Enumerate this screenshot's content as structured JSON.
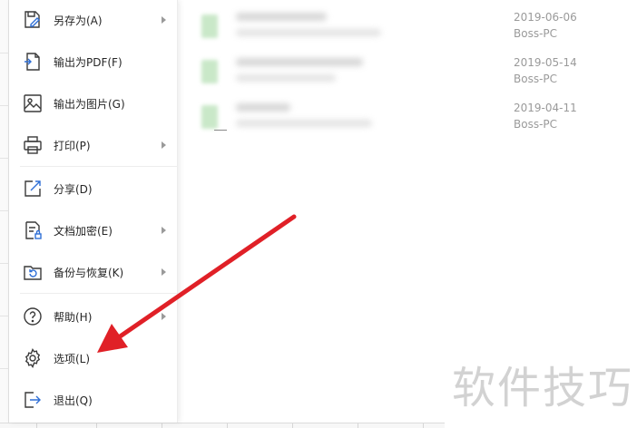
{
  "menu": {
    "items": [
      {
        "label": "另存为(A)",
        "icon": "save-as-icon",
        "submenu": true
      },
      {
        "label": "输出为PDF(F)",
        "icon": "export-pdf-icon",
        "submenu": false
      },
      {
        "label": "输出为图片(G)",
        "icon": "export-image-icon",
        "submenu": false
      },
      {
        "label": "打印(P)",
        "icon": "printer-icon",
        "submenu": true
      },
      {
        "label": "分享(D)",
        "icon": "share-icon",
        "submenu": false
      },
      {
        "label": "文档加密(E)",
        "icon": "document-lock-icon",
        "submenu": true
      },
      {
        "label": "备份与恢复(K)",
        "icon": "backup-restore-icon",
        "submenu": true
      },
      {
        "label": "帮助(H)",
        "icon": "help-icon",
        "submenu": true
      },
      {
        "label": "选项(L)",
        "icon": "gear-icon",
        "submenu": false
      },
      {
        "label": "退出(Q)",
        "icon": "exit-icon",
        "submenu": false
      }
    ]
  },
  "recent_files": [
    {
      "date": "2019-06-06",
      "computer": "Boss-PC"
    },
    {
      "date": "2019-05-14",
      "computer": "Boss-PC"
    },
    {
      "date": "2019-04-11",
      "computer": "Boss-PC"
    }
  ],
  "annotation": {
    "arrow_color": "#e02027",
    "target": "选项(L)"
  },
  "watermark": "软件技巧",
  "colors": {
    "icon_stroke": "#3a3a3a",
    "thumb": "#c9e8c8",
    "meta_text": "#9a9a9a"
  }
}
